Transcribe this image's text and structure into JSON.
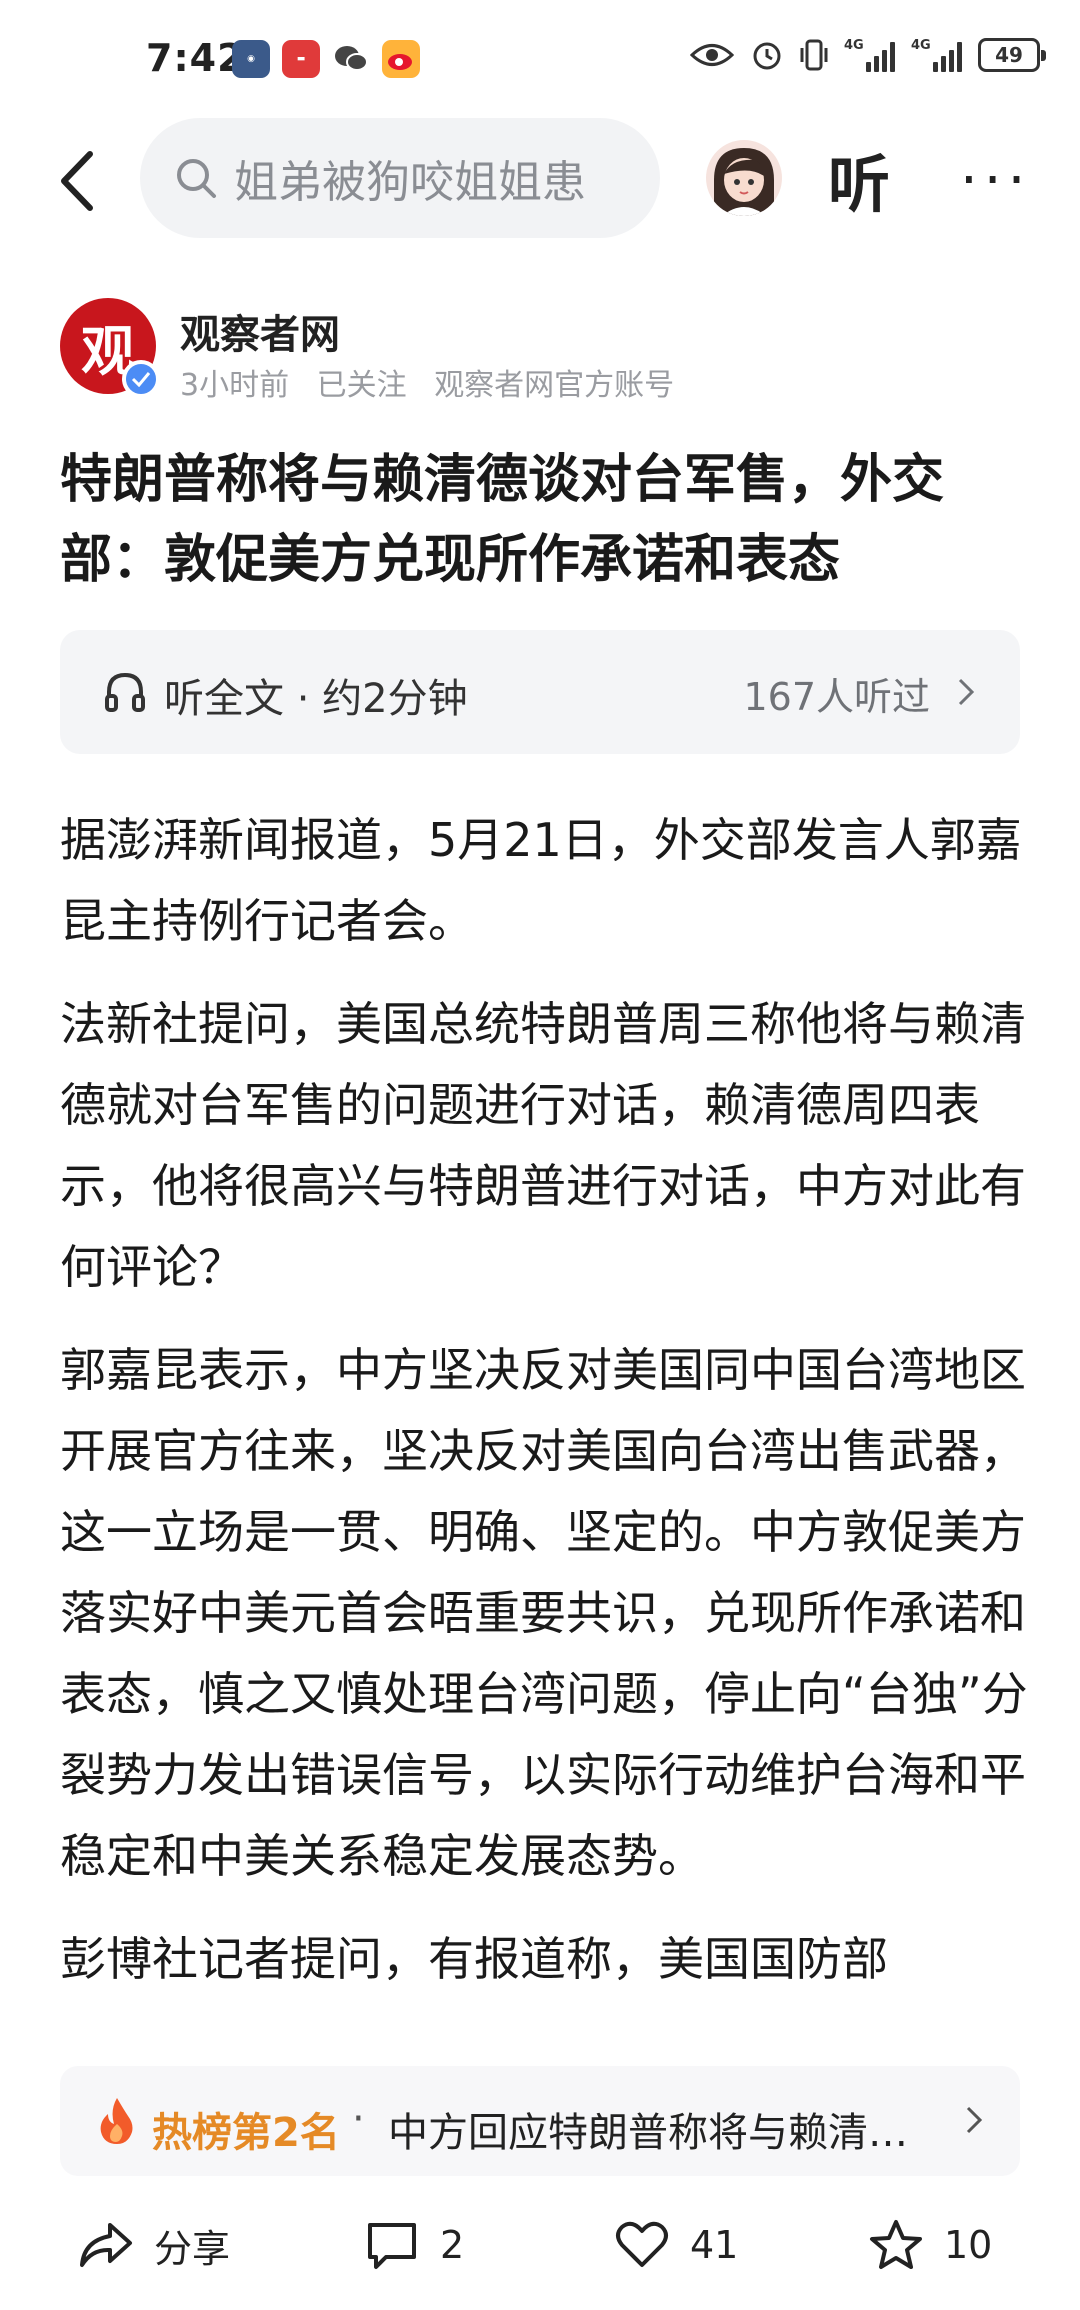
{
  "status_bar": {
    "time": "7:42",
    "battery": "49",
    "network_1": "4G",
    "network_2": "4G"
  },
  "nav": {
    "search_text": "姐弟被狗咬姐姐患",
    "listen_label": "听"
  },
  "author": {
    "logo_char": "观",
    "name": "观察者网",
    "time_ago": "3小时前",
    "follow_status": "已关注",
    "account_type": "观察者网官方账号"
  },
  "article": {
    "title": "特朗普称将与赖清德谈对台军售，外交部：敦促美方兑现所作承诺和表态",
    "listen": {
      "label": "听全文 · 约2分钟",
      "count": "167人听过"
    },
    "paragraphs": [
      "据澎湃新闻报道，5月21日，外交部发言人郭嘉昆主持例行记者会。",
      "法新社提问，美国总统特朗普周三称他将与赖清德就对台军售的问题进行对话，赖清德周四表示，他将很高兴与特朗普进行对话，中方对此有何评论？",
      "郭嘉昆表示，中方坚决反对美国同中国台湾地区开展官方往来，坚决反对美国向台湾出售武器，这一立场是一贯、明确、坚定的。中方敦促美方落实好中美元首会晤重要共识，兑现所作承诺和表态，慎之又慎处理台湾问题，停止向“台独”分裂势力发出错误信号，以实际行动维护台海和平稳定和中美关系稳定发展态势。",
      "彭博社记者提问，有报道称，美国国防部"
    ]
  },
  "hot_rank": {
    "label": "热榜第2名",
    "separator": "·",
    "text": "中方回应特朗普称将与赖清…"
  },
  "actions": {
    "share": "分享",
    "comments": "2",
    "likes": "41",
    "favorites": "10"
  },
  "colors": {
    "brand_red": "#c8161d",
    "hot_orange": "#e58a26",
    "verified_blue": "#4c8cf5"
  }
}
